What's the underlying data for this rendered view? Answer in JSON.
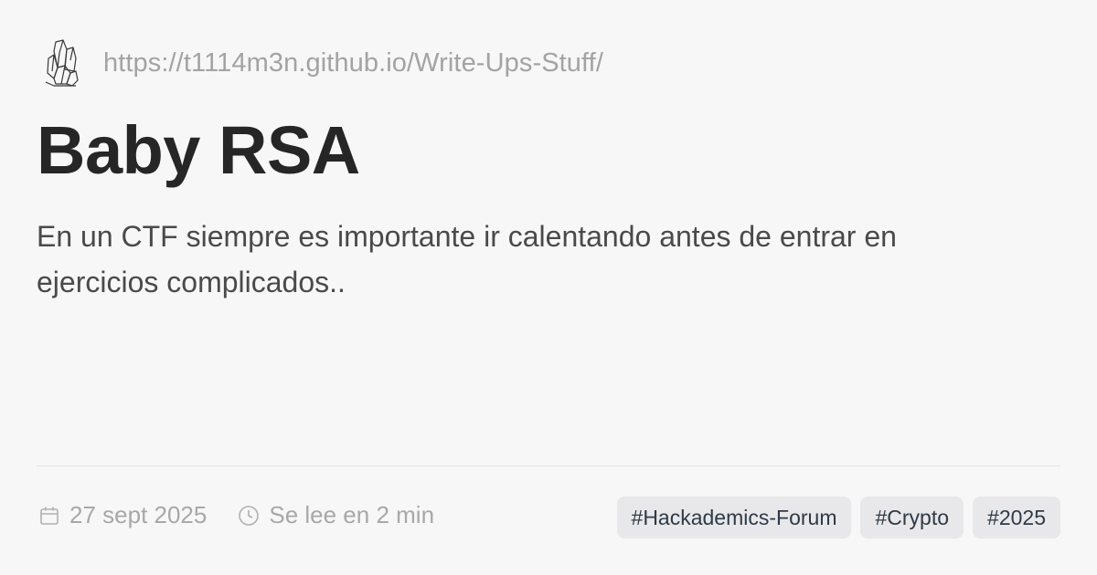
{
  "site": {
    "url": "https://t1114m3n.github.io/Write-Ups-Stuff/",
    "logo_icon": "crystal-cluster-icon"
  },
  "post": {
    "title": "Baby RSA",
    "description": "En un CTF siempre es importante ir calentando antes de entrar en ejercicios complicados.."
  },
  "meta": {
    "date": "27 sept 2025",
    "date_icon": "calendar-icon",
    "reading_time": "Se lee en 2 min",
    "reading_icon": "clock-icon"
  },
  "tags": [
    "#Hackademics-Forum",
    "#Crypto",
    "#2025"
  ],
  "colors": {
    "background": "#f8f7f8",
    "title": "#262626",
    "muted": "#a3a3a3",
    "tag_bg": "#e8e8ea",
    "tag_text": "#2f3a47"
  }
}
